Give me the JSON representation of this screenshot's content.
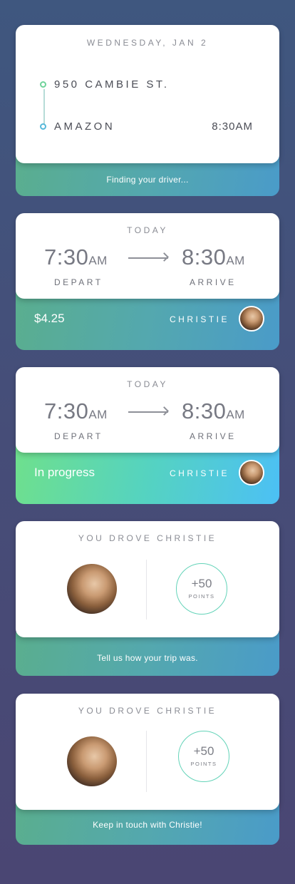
{
  "cards": {
    "c1": {
      "date": "WEDNESDAY, JAN 2",
      "from": "950 CAMBIE ST.",
      "to": "AMAZON",
      "to_time": "8:30AM",
      "footer": "Finding your driver..."
    },
    "c2": {
      "day": "TODAY",
      "depart_time": "7:30",
      "depart_ampm": "AM",
      "arrive_time": "8:30",
      "arrive_ampm": "AM",
      "depart_label": "DEPART",
      "arrive_label": "ARRIVE",
      "price": "$4.25",
      "driver": "CHRISTIE"
    },
    "c3": {
      "day": "TODAY",
      "depart_time": "7:30",
      "depart_ampm": "AM",
      "arrive_time": "8:30",
      "arrive_ampm": "AM",
      "depart_label": "DEPART",
      "arrive_label": "ARRIVE",
      "status": "In progress",
      "driver": "CHRISTIE"
    },
    "c4": {
      "title": "YOU DROVE CHRISTIE",
      "points_value": "+50",
      "points_label": "POINTS",
      "footer": "Tell us how your trip was."
    },
    "c5": {
      "title": "YOU DROVE CHRISTIE",
      "points_value": "+50",
      "points_label": "POINTS",
      "footer": "Keep in touch with Christie!"
    }
  },
  "colors": {
    "footer_gradient": [
      "#5aae8e",
      "#4a9bc9"
    ],
    "footer_bright_gradient": [
      "#6fe08c",
      "#4cc0f5"
    ],
    "origin_dot": "#6fd39a",
    "destination_dot": "#56b8d9"
  }
}
